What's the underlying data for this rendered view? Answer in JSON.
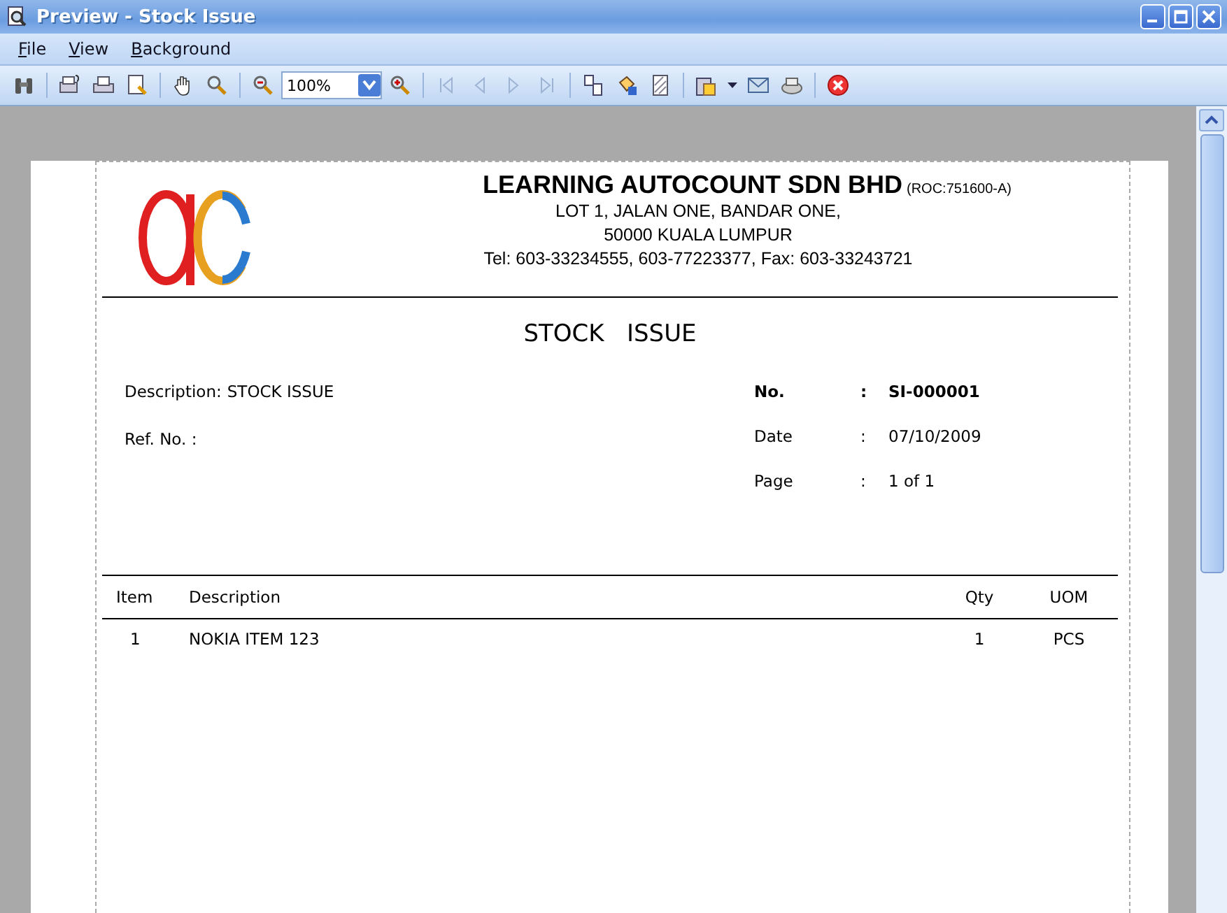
{
  "window": {
    "title": "Preview - Stock Issue"
  },
  "menu": [
    {
      "label": "File"
    },
    {
      "label": "View"
    },
    {
      "label": "Background"
    }
  ],
  "toolbar": {
    "zoom": "100%",
    "nav_buttons": [
      {
        "kind": "first",
        "disabled": true
      },
      {
        "kind": "prev",
        "disabled": true
      },
      {
        "kind": "next",
        "disabled": true
      },
      {
        "kind": "last",
        "disabled": true
      }
    ]
  },
  "document": {
    "company": "LEARNING AUTOCOUNT SDN BHD",
    "reg_no": "(ROC:751600-A)",
    "address": [
      "LOT 1, JALAN ONE,  BANDAR ONE,",
      "50000  KUALA LUMPUR",
      "Tel:  603-33234555,  603-77223377,  Fax: 603-33243721"
    ],
    "title": "STOCK   ISSUE",
    "left_fields": [
      {
        "label": "Description:",
        "value": "STOCK ISSUE"
      },
      {
        "label": "Ref. No.    :"
      }
    ],
    "right_fields": [
      {
        "label": "No.",
        "colon": ":",
        "value": "SI-000001",
        "bold": true
      },
      {
        "label": "Date",
        "colon": ":",
        "value": "07/10/2009",
        "bold": false
      },
      {
        "label": "Page",
        "colon": ":",
        "value": "1 of 1",
        "bold": false
      }
    ],
    "table": {
      "columns": [
        "Item",
        "Description",
        "Qty",
        "UOM"
      ],
      "rows": [
        [
          "1",
          "NOKIA ITEM 123",
          "1",
          "PCS"
        ]
      ]
    }
  }
}
